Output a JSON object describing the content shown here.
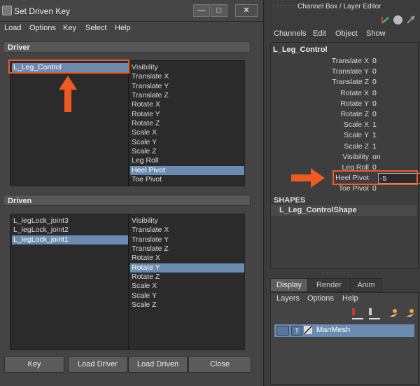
{
  "left_window": {
    "title": "Set Driven Key",
    "menu": [
      "Load",
      "Options",
      "Key",
      "Select",
      "Help"
    ],
    "driver": {
      "header": "Driver",
      "objects": [
        {
          "label": "L_Leg_Control",
          "selected": true
        }
      ],
      "attributes": [
        {
          "label": "Visibility",
          "selected": false
        },
        {
          "label": "Translate X",
          "selected": false
        },
        {
          "label": "Translate Y",
          "selected": false
        },
        {
          "label": "Translate Z",
          "selected": false
        },
        {
          "label": "Rotate X",
          "selected": false
        },
        {
          "label": "Rotate Y",
          "selected": false
        },
        {
          "label": "Rotate Z",
          "selected": false
        },
        {
          "label": "Scale X",
          "selected": false
        },
        {
          "label": "Scale Y",
          "selected": false
        },
        {
          "label": "Scale Z",
          "selected": false
        },
        {
          "label": "Leg Roll",
          "selected": false
        },
        {
          "label": "Heel Pivot",
          "selected": true
        },
        {
          "label": "Toe Pivot",
          "selected": false
        }
      ]
    },
    "driven": {
      "header": "Driven",
      "objects": [
        {
          "label": "L_legLock_joint3",
          "selected": false
        },
        {
          "label": "L_legLock_joint2",
          "selected": false
        },
        {
          "label": "L_legLock_joint1",
          "selected": true
        }
      ],
      "attributes": [
        {
          "label": "Visibility",
          "selected": false
        },
        {
          "label": "Translate X",
          "selected": false
        },
        {
          "label": "Translate Y",
          "selected": false
        },
        {
          "label": "Translate Z",
          "selected": false
        },
        {
          "label": "Rotate X",
          "selected": false
        },
        {
          "label": "Rotate Y",
          "selected": true
        },
        {
          "label": "Rotate Z",
          "selected": false
        },
        {
          "label": "Scale X",
          "selected": false
        },
        {
          "label": "Scale Y",
          "selected": false
        },
        {
          "label": "Scale Z",
          "selected": false
        }
      ]
    },
    "buttons": {
      "key": "Key",
      "load_driver": "Load Driver",
      "load_driven": "Load Driven",
      "close": "Close"
    }
  },
  "channel_box": {
    "title": "Channel Box / Layer Editor",
    "menu": [
      "Channels",
      "Edit",
      "Object",
      "Show"
    ],
    "object_name": "L_Leg_Control",
    "attributes": [
      {
        "label": "Translate X",
        "value": "0"
      },
      {
        "label": "Translate Y",
        "value": "0"
      },
      {
        "label": "Translate Z",
        "value": "0"
      },
      {
        "label": "Rotate X",
        "value": "0"
      },
      {
        "label": "Rotate Y",
        "value": "0"
      },
      {
        "label": "Rotate Z",
        "value": "0"
      },
      {
        "label": "Scale X",
        "value": "1"
      },
      {
        "label": "Scale Y",
        "value": "1"
      },
      {
        "label": "Scale Z",
        "value": "1"
      },
      {
        "label": "Visibility",
        "value": "on"
      },
      {
        "label": "Leg Roll",
        "value": "0"
      },
      {
        "label": "Heel Pivot",
        "value": "-5"
      },
      {
        "label": "Toe Pivot",
        "value": "0"
      }
    ],
    "shapes_header": "SHAPES",
    "shape_name": "L_Leg_ControlShape",
    "tabs": [
      "Display",
      "Render",
      "Anim"
    ],
    "layer_menu": [
      "Layers",
      "Options",
      "Help"
    ],
    "layer": {
      "visibility": "",
      "type": "T",
      "name": "ManMesh"
    }
  },
  "colors": {
    "highlight": "#ee5a1f",
    "selection": "#6a8cb0"
  }
}
